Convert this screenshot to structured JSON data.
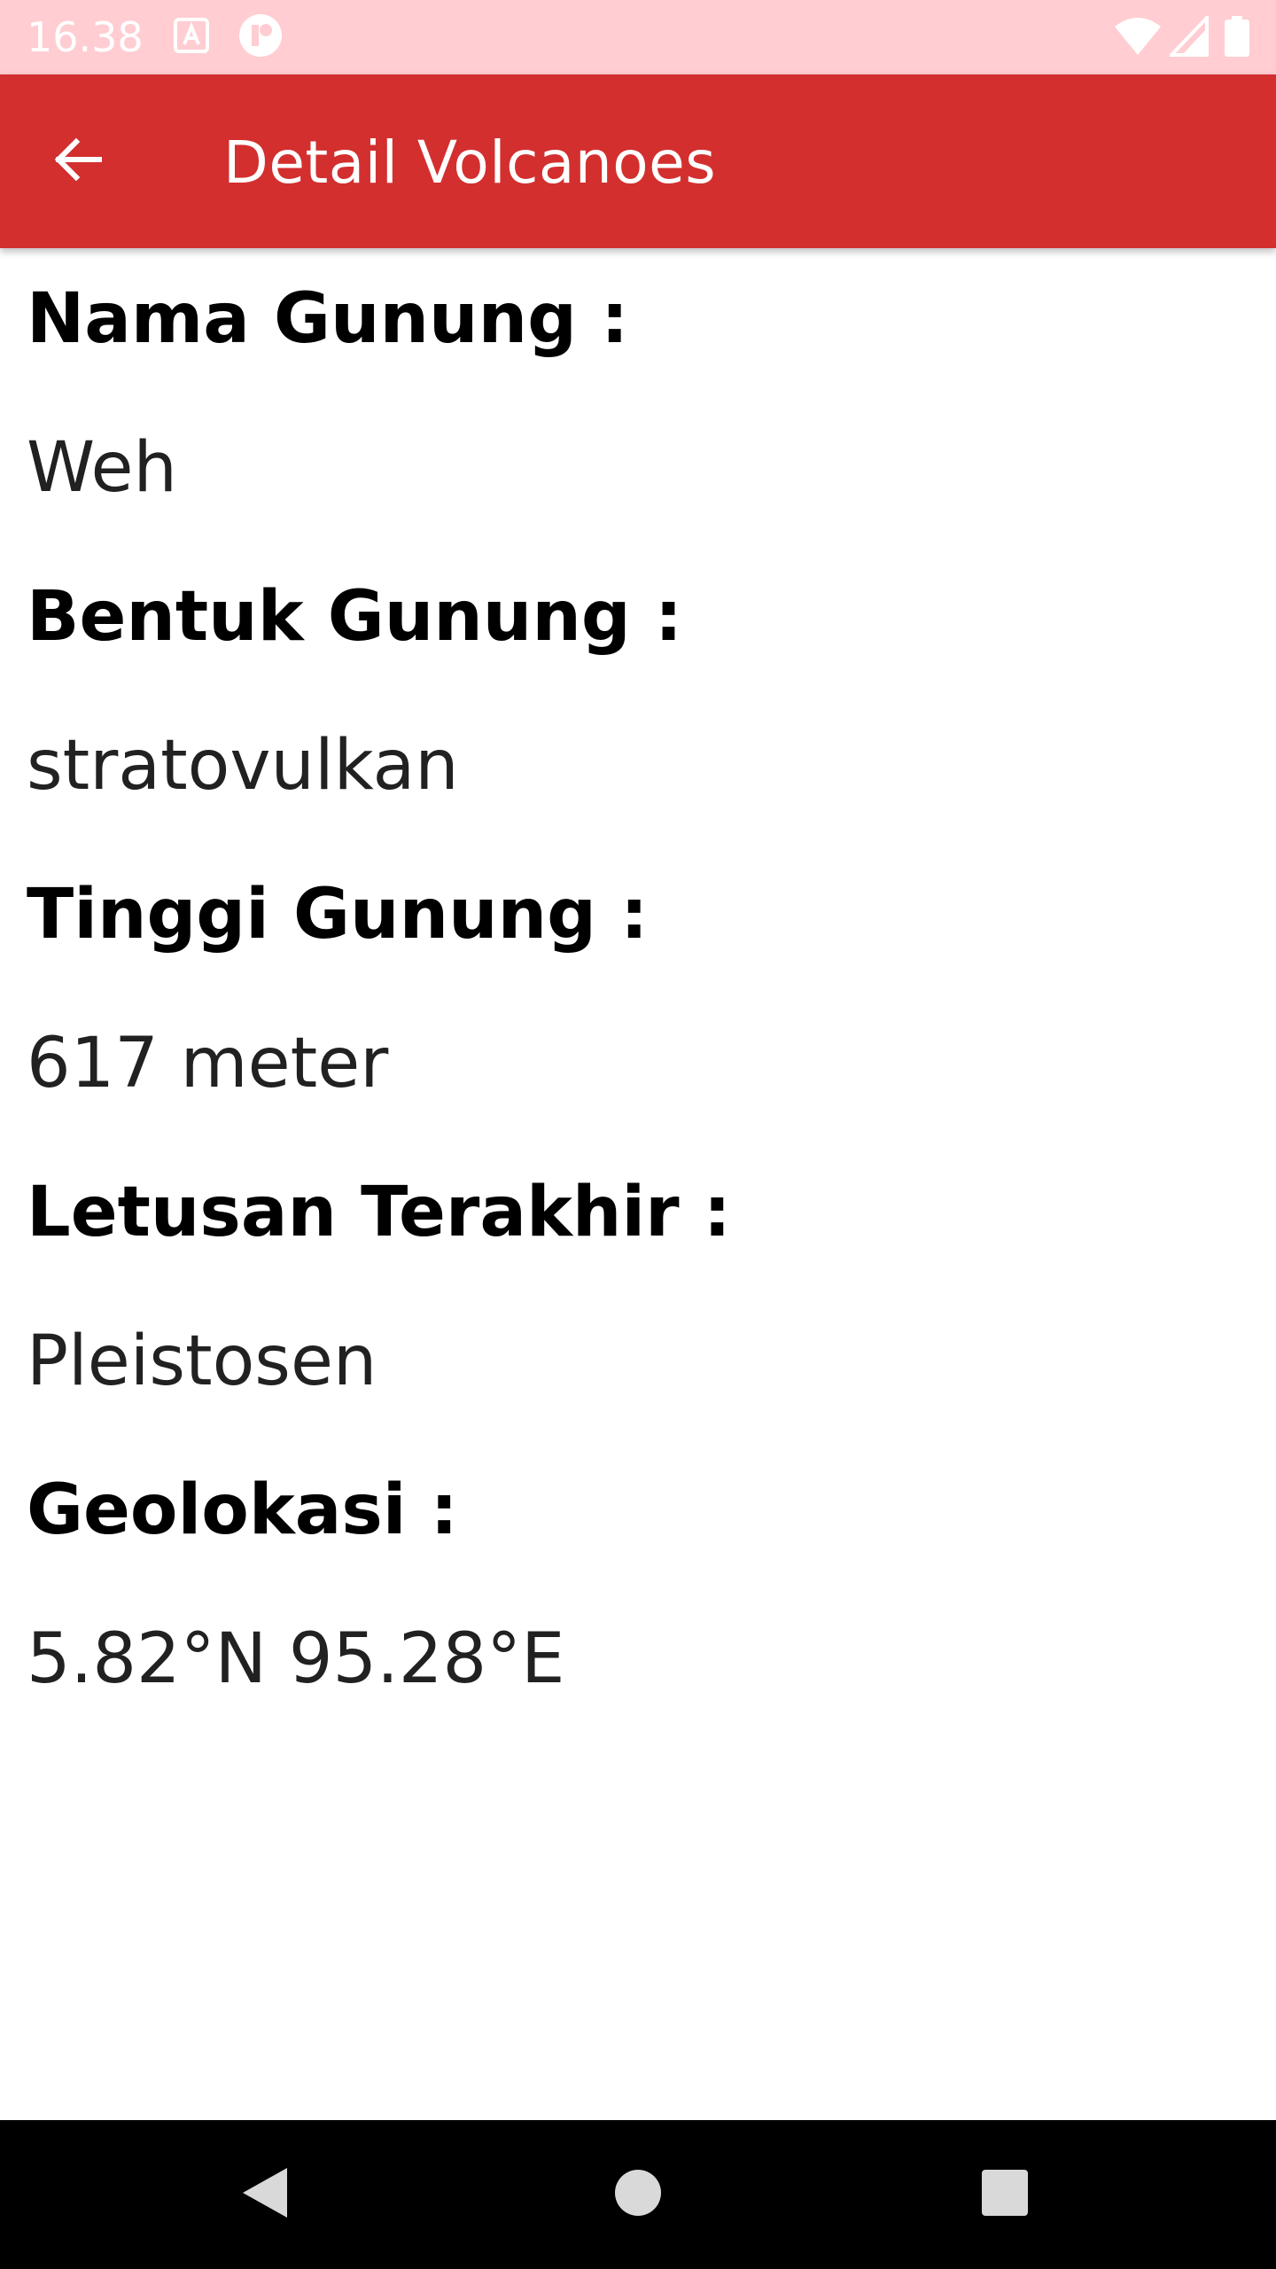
{
  "status_bar": {
    "time": "16.38",
    "background": "#ffcdd2",
    "left_icons": [
      "translate-app-icon",
      "notification-badge-icon"
    ],
    "right_icons": [
      "wifi-icon",
      "cellular-signal-icon",
      "battery-icon"
    ]
  },
  "app_bar": {
    "title": "Detail Volcanoes",
    "background": "#d32f2f",
    "back_icon": "arrow-back-icon"
  },
  "details": [
    {
      "label": "Nama Gunung :",
      "value": "Weh"
    },
    {
      "label": "Bentuk Gunung :",
      "value": "stratovulkan"
    },
    {
      "label": "Tinggi Gunung :",
      "value": "617 meter"
    },
    {
      "label": "Letusan Terakhir :",
      "value": "Pleistosen"
    },
    {
      "label": "Geolokasi :",
      "value": "5.82°N 95.28°E"
    }
  ],
  "nav_bar": {
    "background": "#000000",
    "buttons": [
      "nav-back-icon",
      "nav-home-icon",
      "nav-recents-icon"
    ]
  }
}
